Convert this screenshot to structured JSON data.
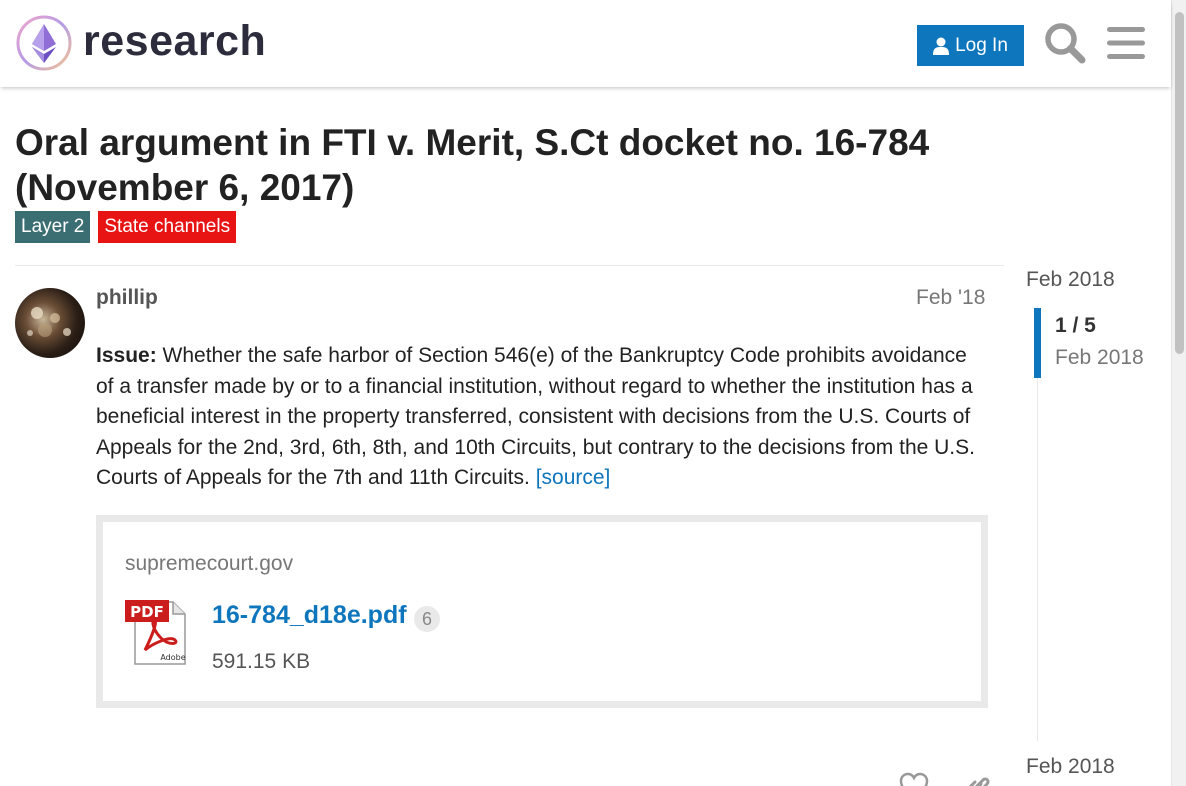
{
  "header": {
    "site_name": "research",
    "login_label": "Log In"
  },
  "topic": {
    "title": "Oral argument in FTI v. Merit, S.Ct docket no. 16-784 (November 6, 2017)",
    "tags": [
      "Layer 2",
      "State channels"
    ]
  },
  "post": {
    "username": "phillip",
    "date": "Feb '18",
    "issue_label": "Issue:",
    "body": " Whether the safe harbor of Section 546(e) of the Bankruptcy Code prohibits avoidance of a transfer made by or to a financial institution, without regard to whether the institution has a beneficial interest in the property transferred, consistent with decisions from the U.S. Courts of Appeals for the 2nd, 3rd, 6th, 8th, and 10th Circuits, but contrary to the decisions from the U.S. Courts of Appeals for the 7th and 11th Circuits. ",
    "source_link": "[source]",
    "onebox": {
      "source": "supremecourt.gov",
      "filename": "16-784_d18e.pdf",
      "clicks": "6",
      "size": "591.15 KB"
    }
  },
  "timeline": {
    "start": "Feb 2018",
    "position": "1 / 5",
    "position_date": "Feb 2018",
    "end": "Feb 2018"
  },
  "colors": {
    "accent": "#0e76bd",
    "tag_layer2": "#3b6e72",
    "tag_state_channels": "#e81414"
  }
}
